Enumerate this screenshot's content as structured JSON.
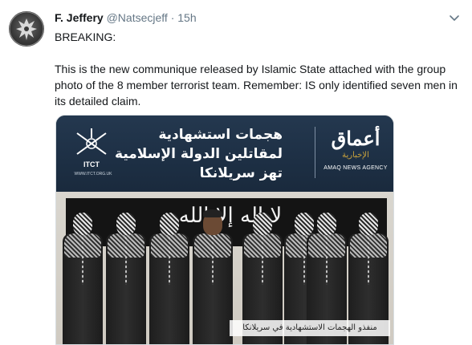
{
  "tweet": {
    "author_name": "F. Jeffery",
    "handle": "@Natsecjeff",
    "separator": "·",
    "time": "15h",
    "paragraphs": [
      "BREAKING:",
      "This is the new communique released by Islamic State attached with the group photo of the 8 member terrorist team. Remember: IS only identified seven men in its detailed claim."
    ]
  },
  "media": {
    "banner_title": "هجمات استشهادية لمقاتلين الدولة الإسلامية تهز سريلانكا",
    "itct_label": "ITCT",
    "itct_url": "WWW.ITCT.ORG.UK",
    "amaq_arabic": "أعماق",
    "amaq_arabic_sub": "الإخبارية",
    "amaq_english": "AMAQ NEWS AGENCY",
    "flag_text": "لا إله إلا الله",
    "caption": "منفذو الهجمات الاستشهادية في سريلانكا"
  },
  "icons": {
    "more_options": "chevron-down-icon",
    "avatar": "phoenix-emblem"
  },
  "colors": {
    "banner_bg": "#1d2f44",
    "text_primary": "#14171a",
    "text_secondary": "#657786",
    "amaq_gold": "#c8a23c"
  }
}
